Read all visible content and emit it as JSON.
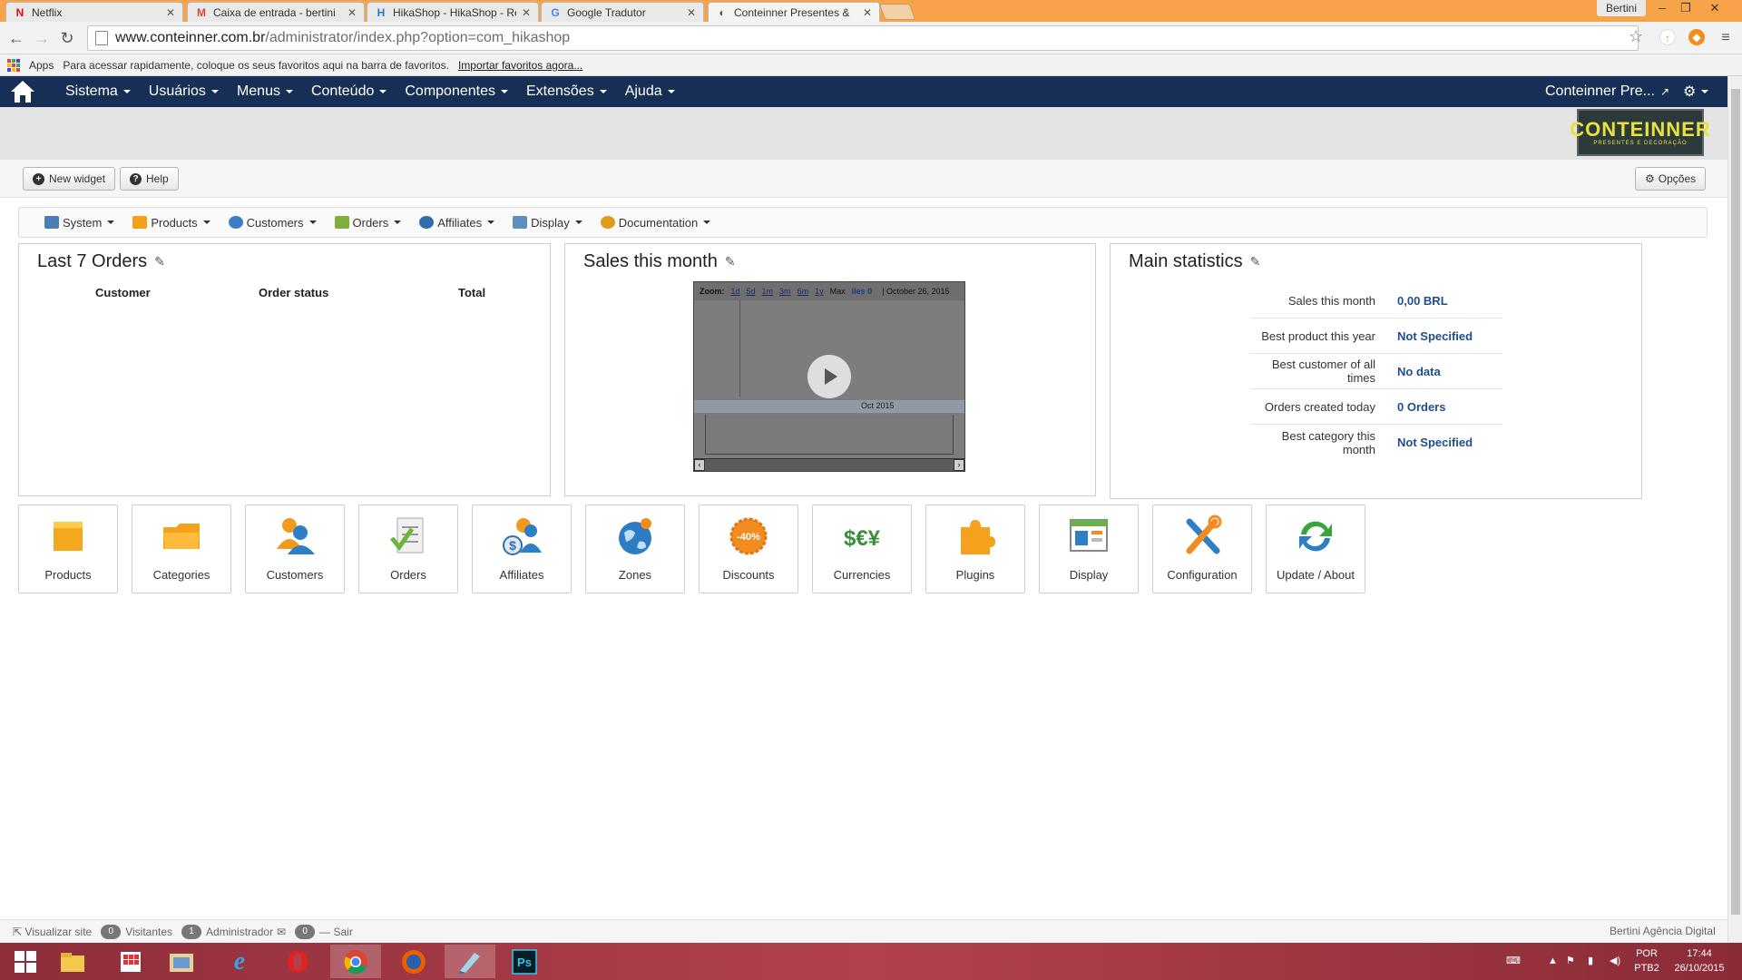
{
  "browser": {
    "tabs": [
      {
        "label": "Netflix",
        "favicon": "N",
        "color": "#e50914"
      },
      {
        "label": "Caixa de entrada - bertini",
        "favicon": "M",
        "color": "#d44638"
      },
      {
        "label": "HikaShop - HikaShop - Re",
        "favicon": "H",
        "color": "#2b7bb9"
      },
      {
        "label": "Google Tradutor",
        "favicon": "G",
        "color": "#4285f4"
      },
      {
        "label": "Conteinner Presentes &",
        "favicon": "◐",
        "color": "#555555"
      }
    ],
    "user": "Bertini",
    "url_host": "www.conteinner.com.br",
    "url_path": "/administrator/index.php?option=com_hikashop",
    "apps_label": "Apps",
    "bookmarks_hint": "Para acessar rapidamente, coloque os seus favoritos aqui na barra de favoritos.",
    "bookmarks_link": "Importar favoritos agora..."
  },
  "admin_nav": {
    "items": [
      "Sistema",
      "Usuários",
      "Menus",
      "Conteúdo",
      "Componentes",
      "Extensões",
      "Ajuda"
    ],
    "site_name": "Conteinner Pre..."
  },
  "logo": {
    "title": "CONTEINNER",
    "subtitle": "PRESENTES E DECORAÇÃO"
  },
  "toolbar": {
    "new_widget": "New widget",
    "help": "Help",
    "options": "Opções"
  },
  "hika_menu": [
    {
      "label": "System",
      "color": "#4a7fb5"
    },
    {
      "label": "Products",
      "color": "#f2a21a"
    },
    {
      "label": "Customers",
      "color": "#3d7fc4"
    },
    {
      "label": "Orders",
      "color": "#7fae3c"
    },
    {
      "label": "Affiliates",
      "color": "#2f6fae"
    },
    {
      "label": "Display",
      "color": "#5a8fc0"
    },
    {
      "label": "Documentation",
      "color": "#e09a1e"
    }
  ],
  "panels": {
    "orders": {
      "title": "Last 7 Orders",
      "columns": [
        "Customer",
        "Order status",
        "Total"
      ]
    },
    "sales": {
      "title": "Sales this month",
      "zoom_label": "Zoom:",
      "zoom_options": [
        "1d",
        "5d",
        "1m",
        "3m",
        "6m",
        "1y"
      ],
      "max_label": "Max",
      "series_label": "iles 0",
      "date_label": "October 26, 2015",
      "axis_label": "Oct 2015"
    },
    "stats": {
      "title": "Main statistics",
      "rows": [
        {
          "label": "Sales this month",
          "value": "0,00 BRL"
        },
        {
          "label": "Best product this year",
          "value": "Not Specified"
        },
        {
          "label": "Best customer of all times",
          "value": "No data"
        },
        {
          "label": "Orders created today",
          "value": "0 Orders"
        },
        {
          "label": "Best category this month",
          "value": "Not Specified"
        }
      ]
    }
  },
  "tiles": [
    {
      "label": "Products",
      "icon": "box-icon"
    },
    {
      "label": "Categories",
      "icon": "folder-icon"
    },
    {
      "label": "Customers",
      "icon": "customers-icon"
    },
    {
      "label": "Orders",
      "icon": "orders-icon"
    },
    {
      "label": "Affiliates",
      "icon": "affiliates-icon"
    },
    {
      "label": "Zones",
      "icon": "globe-icon"
    },
    {
      "label": "Discounts",
      "icon": "discount-icon"
    },
    {
      "label": "Currencies",
      "icon": "currencies-icon"
    },
    {
      "label": "Plugins",
      "icon": "puzzle-icon"
    },
    {
      "label": "Display",
      "icon": "display-icon"
    },
    {
      "label": "Configuration",
      "icon": "tools-icon"
    },
    {
      "label": "Update / About",
      "icon": "update-icon"
    }
  ],
  "discount_badge": "-40%",
  "currency_symbols": "$€¥",
  "status": {
    "visit_site": "Visualizar site",
    "visitors_count": "0",
    "visitors_label": "Visitantes",
    "admin_count": "1",
    "admin_label": "Administrador",
    "messages_count": "0",
    "logout": "Sair",
    "credit": "Bertini Agência Digital"
  },
  "taskbar": {
    "lang": "POR",
    "layout": "PTB2",
    "time": "17:44",
    "date": "26/10/2015"
  }
}
